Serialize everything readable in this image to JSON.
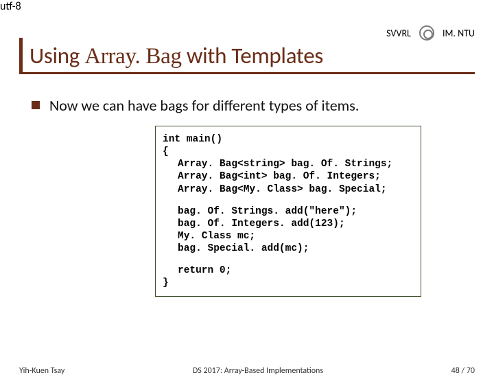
{
  "header": {
    "left": "SVVRL",
    "right": "IM. NTU"
  },
  "title": {
    "pre": "Using ",
    "code": "Array. Bag",
    "post": " with Templates"
  },
  "bullet": "Now we can have bags for different types of items.",
  "code": {
    "l1": "int main()",
    "l2": "{",
    "l3": "Array. Bag<string> bag. Of. Strings;",
    "l4": "Array. Bag<int> bag. Of. Integers;",
    "l5": "Array. Bag<My. Class> bag. Special;",
    "l6": "bag. Of. Strings. add(\"here\");",
    "l7": "bag. Of. Integers. add(123);",
    "l8": "My. Class mc;",
    "l9": "bag. Special. add(mc);",
    "l10": "return 0;",
    "l11": "}"
  },
  "footer": {
    "author": "Yih-Kuen Tsay",
    "center": "DS 2017: Array-Based Implementations",
    "page": "48 / 70"
  }
}
